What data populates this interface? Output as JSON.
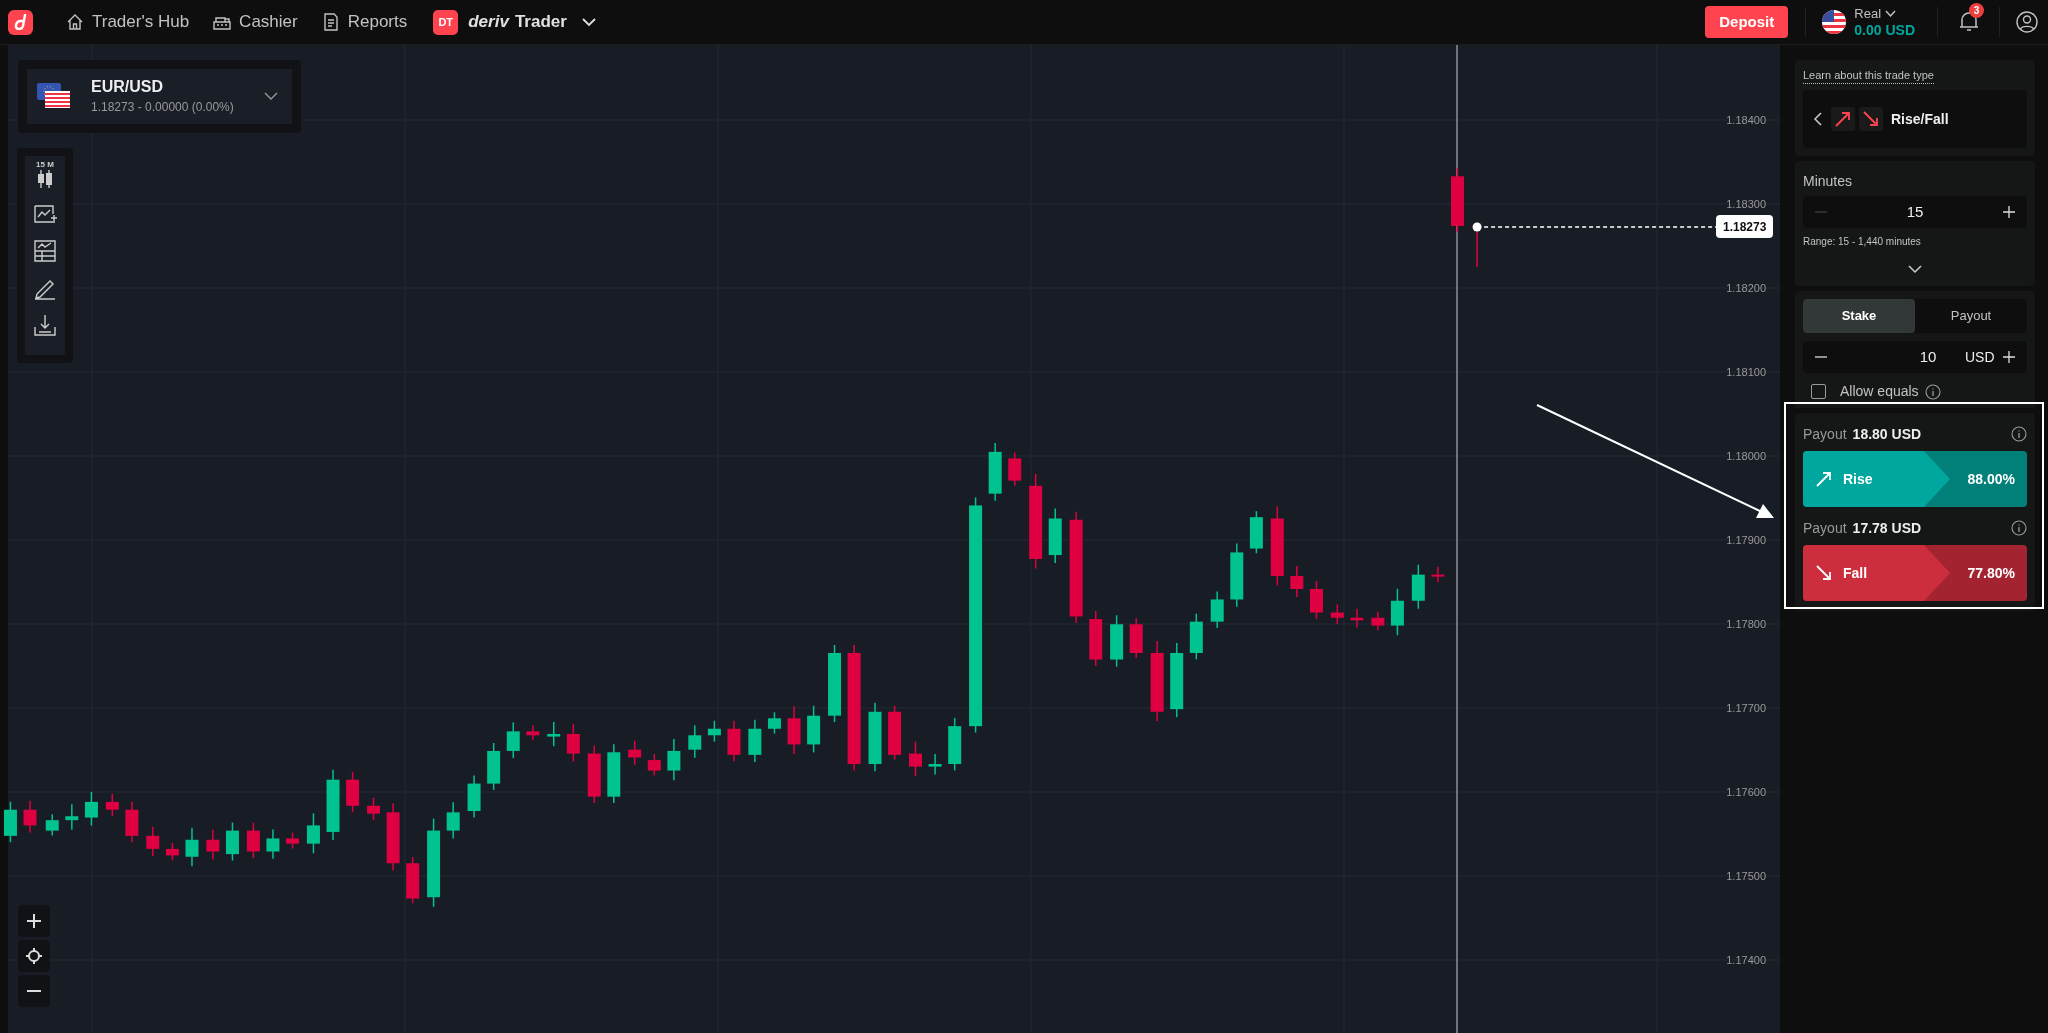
{
  "nav": {
    "items": [
      {
        "kind": "home",
        "label": "Trader's Hub"
      },
      {
        "kind": "cashier",
        "label": "Cashier"
      },
      {
        "kind": "reports",
        "label": "Reports"
      }
    ],
    "app_logo": {
      "badge": "DT",
      "brand": "deriv",
      "name": "Trader"
    }
  },
  "deposit_button": "Deposit",
  "account": {
    "type": "Real",
    "balance": "0.00 USD"
  },
  "notifications": {
    "count": "3"
  },
  "symbol": {
    "name": "EUR/USD",
    "quote": "1.18273 - 0.00000 (0.00%)"
  },
  "chart": {
    "interval": "15 M",
    "y_axis_labels": [
      "1.18400",
      "1.18300",
      "1.18200",
      "1.18100",
      "1.18000",
      "1.17900",
      "1.17800",
      "1.17700",
      "1.17600",
      "1.17500",
      "1.17400"
    ],
    "current_price": "1.18273"
  },
  "trade": {
    "learn_link": "Learn about this trade type",
    "trade_type": "Rise/Fall",
    "duration": {
      "unit": "Minutes",
      "value": "15",
      "range": "Range: 15 - 1,440 minutes",
      "decrease_disabled": true
    },
    "amount_tabs": [
      {
        "label": "Stake",
        "selected": true
      },
      {
        "label": "Payout",
        "selected": false
      }
    ],
    "amount": {
      "value": "10",
      "currency": "USD"
    },
    "allow_equals": {
      "label": "Allow equals",
      "checked": false
    },
    "purchase": [
      {
        "kind": "rise",
        "payout_label": "Payout",
        "payout": "18.80 USD",
        "label": "Rise",
        "percent": "88.00%"
      },
      {
        "kind": "fall",
        "payout_label": "Payout",
        "payout": "17.78 USD",
        "label": "Fall",
        "percent": "77.80%"
      }
    ]
  }
}
